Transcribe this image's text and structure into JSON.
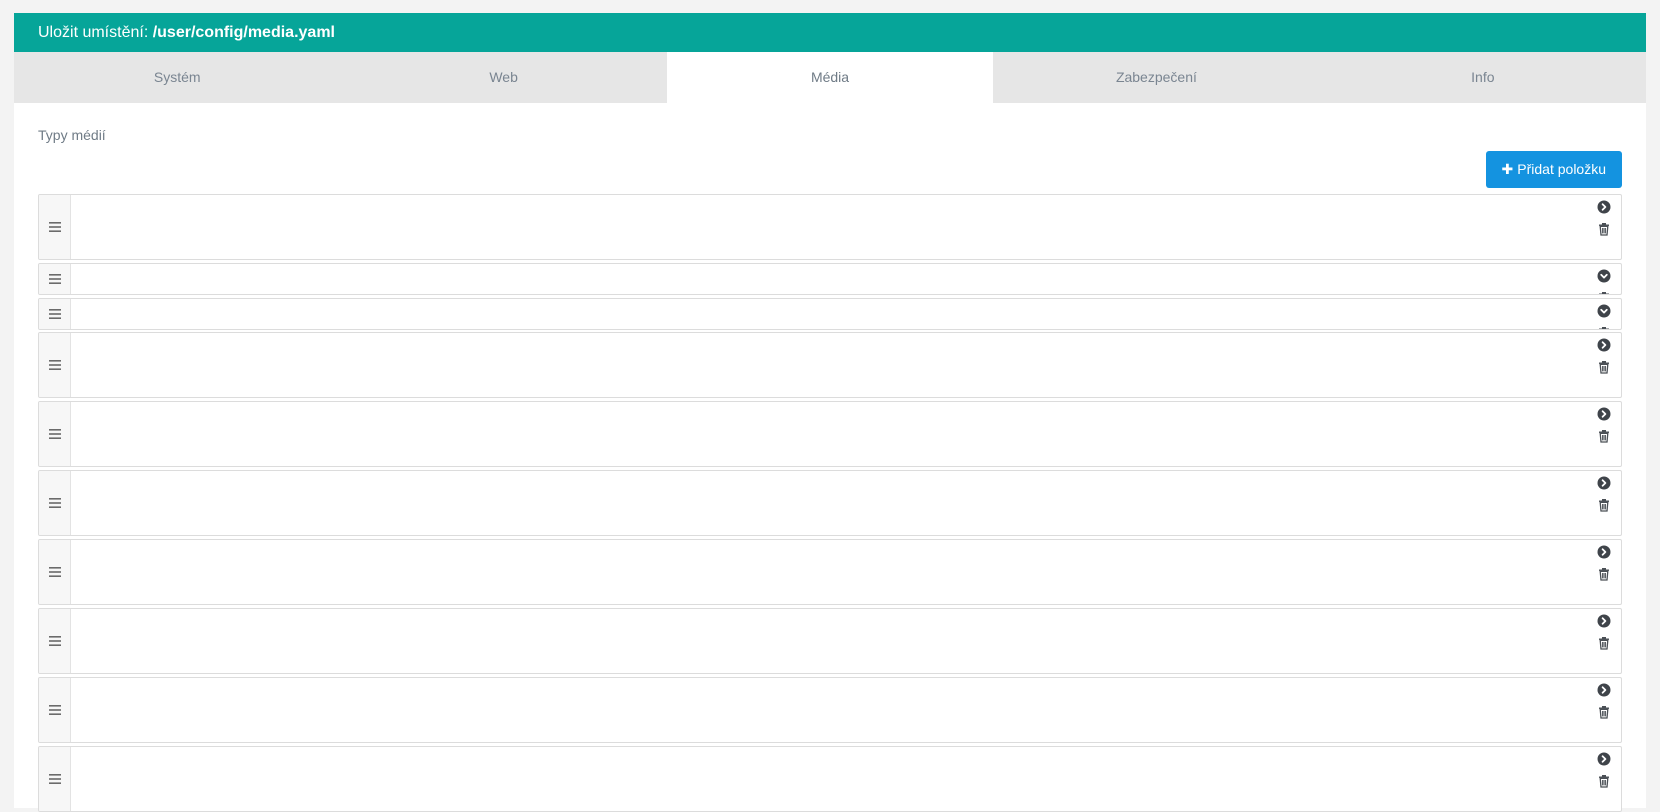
{
  "save_bar": {
    "prefix": "Uložit umístění: ",
    "path": "/user/config/media.yaml"
  },
  "tabs": [
    {
      "label": "Systém",
      "active": false
    },
    {
      "label": "Web",
      "active": false
    },
    {
      "label": "Média",
      "active": true
    },
    {
      "label": "Zabezpečení",
      "active": false
    },
    {
      "label": "Info",
      "active": false
    }
  ],
  "section": {
    "label": "Typy médií"
  },
  "add_button": {
    "icon": "plus-icon",
    "label": "Přidat položku"
  },
  "colors": {
    "save_bar": "#06a599",
    "add_button": "#1493e0",
    "tab_inactive_bg": "#e6e6e6"
  },
  "items": [
    {
      "state": "collapsed",
      "toggle_icon": "chevron-right-circle-icon",
      "delete_icon": "trash-icon"
    },
    {
      "state": "expanded",
      "toggle_icon": "chevron-down-circle-icon",
      "delete_icon": "trash-icon"
    },
    {
      "state": "expanded",
      "toggle_icon": "chevron-down-circle-icon",
      "delete_icon": "trash-icon"
    },
    {
      "state": "collapsed",
      "toggle_icon": "chevron-right-circle-icon",
      "delete_icon": "trash-icon"
    },
    {
      "state": "collapsed",
      "toggle_icon": "chevron-right-circle-icon",
      "delete_icon": "trash-icon"
    },
    {
      "state": "collapsed",
      "toggle_icon": "chevron-right-circle-icon",
      "delete_icon": "trash-icon"
    },
    {
      "state": "collapsed",
      "toggle_icon": "chevron-right-circle-icon",
      "delete_icon": "trash-icon"
    },
    {
      "state": "collapsed",
      "toggle_icon": "chevron-right-circle-icon",
      "delete_icon": "trash-icon"
    },
    {
      "state": "collapsed",
      "toggle_icon": "chevron-right-circle-icon",
      "delete_icon": "trash-icon"
    },
    {
      "state": "collapsed",
      "toggle_icon": "chevron-right-circle-icon",
      "delete_icon": "trash-icon"
    }
  ]
}
